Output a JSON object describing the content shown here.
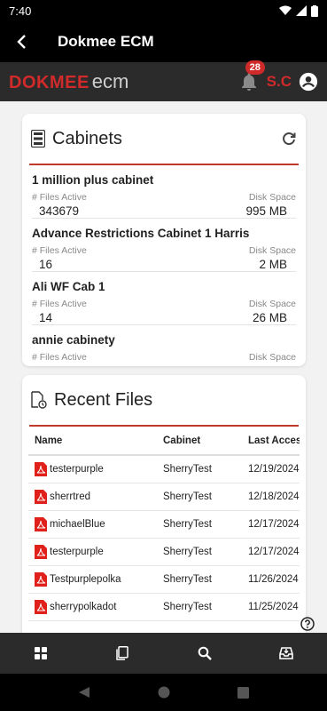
{
  "status": {
    "time": "7:40"
  },
  "app_bar": {
    "title": "Dokmee ECM"
  },
  "brand": {
    "logo_part1": "DOKMEE",
    "logo_part2": "ecm",
    "notification_count": "28",
    "user_initials": "S.C"
  },
  "cabinets": {
    "title": "Cabinets",
    "items": [
      {
        "name": "1 million plus cabinet",
        "files_label": "# Files Active",
        "space_label": "Disk Space",
        "files": "343679",
        "space": "995 MB"
      },
      {
        "name": "Advance Restrictions Cabinet 1 Harris",
        "files_label": "# Files Active",
        "space_label": "Disk Space",
        "files": "16",
        "space": "2 MB"
      },
      {
        "name": "Ali WF Cab 1",
        "files_label": "# Files Active",
        "space_label": "Disk Space",
        "files": "14",
        "space": "26 MB"
      },
      {
        "name": "annie cabinety",
        "files_label": "# Files Active",
        "space_label": "Disk Space",
        "files": "",
        "space": ""
      }
    ]
  },
  "recent": {
    "title": "Recent Files",
    "columns": [
      "Name",
      "Cabinet",
      "Last Acces"
    ],
    "rows": [
      {
        "name": "testerpurple",
        "cabinet": "SherryTest",
        "date": "12/19/2024"
      },
      {
        "name": "sherrtred",
        "cabinet": "SherryTest",
        "date": "12/18/2024"
      },
      {
        "name": "michaelBlue",
        "cabinet": "SherryTest",
        "date": "12/17/2024"
      },
      {
        "name": "testerpurple",
        "cabinet": "SherryTest",
        "date": "12/17/2024"
      },
      {
        "name": "Testpurplepolka",
        "cabinet": "SherryTest",
        "date": "11/26/2024"
      },
      {
        "name": "sherrypolkadot",
        "cabinet": "SherryTest",
        "date": "11/25/2024"
      }
    ]
  },
  "colors": {
    "accent": "#d02a2a",
    "brand_bg": "#2b2b2b",
    "app_bar_bg": "#000000"
  },
  "icons": [
    "back-arrow-icon",
    "bell-icon",
    "account-icon",
    "cabinet-icon",
    "refresh-icon",
    "recent-file-icon",
    "pdf-icon",
    "help-icon",
    "dashboard-icon",
    "documents-icon",
    "search-icon",
    "inbox-icon"
  ]
}
